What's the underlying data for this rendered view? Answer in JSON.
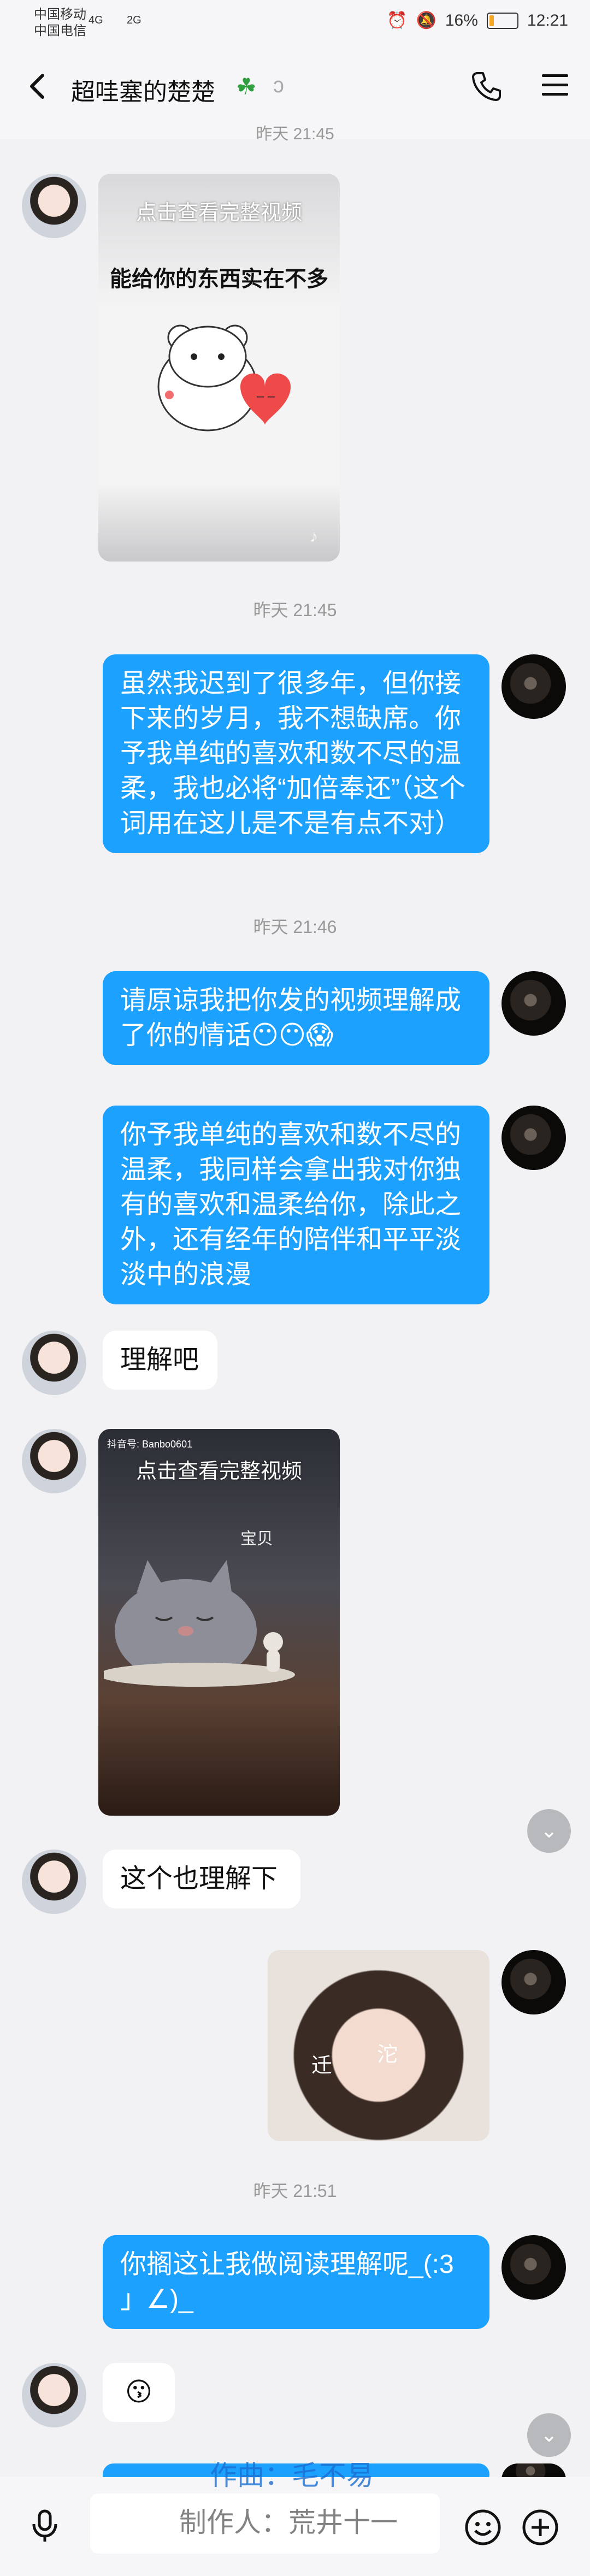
{
  "status_bar": {
    "carrier_1": "中国移动",
    "carrier_2": "中国电信",
    "signal_1": "4G",
    "signal_2": "2G",
    "battery": "16%",
    "time": "12:21"
  },
  "header": {
    "title": "超哇塞的楚楚",
    "clover_icon": "clover-icon",
    "ear_icon": "ear-icon"
  },
  "messages": {
    "ts_top": "昨天 21:45",
    "video1_caption": "点击查看完整视频",
    "video1_text": "能给你的东西实在不多",
    "ts1": "昨天 21:45",
    "msg1": "虽然我迟到了很多年，但你接下来的岁月，我不想缺席。你予我单纯的喜欢和数不尽的温柔，我也必将“加倍奉还”（这个词用在这儿是不是有点不对）",
    "ts2": "昨天 21:46",
    "msg2": "请原谅我把你发的视频理解成了你的情话😶😶😱",
    "msg3": "你予我单纯的喜欢和数不尽的温柔，我同样会拿出我对你独有的喜欢和温柔给你，除此之外，还有经年的陪伴和平平淡淡中的浪漫",
    "msg4": "理解吧",
    "video2_caption": "点击查看完整视频",
    "video2_watermark": "抖音号: Banbo0601",
    "video2_text": "宝贝",
    "msg5": "这个也理解下",
    "photo_text_1": "迁",
    "photo_text_2": "沱",
    "ts3": "昨天 21:51",
    "msg6": "你搁这让我做阅读理解呢_(:3 」∠)_",
    "msg7": "😗"
  },
  "overlay": {
    "line1": "作曲：毛不易",
    "line2": "制作人：荒井十一"
  }
}
